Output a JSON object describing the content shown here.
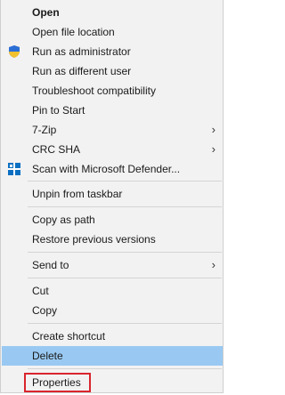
{
  "menu": {
    "items": [
      {
        "label": "Open",
        "bold": true
      },
      {
        "label": "Open file location"
      },
      {
        "label": "Run as administrator",
        "icon": "uac-shield-icon"
      },
      {
        "label": "Run as different user"
      },
      {
        "label": "Troubleshoot compatibility"
      },
      {
        "label": "Pin to Start"
      },
      {
        "label": "7-Zip",
        "submenu": true
      },
      {
        "label": "CRC SHA",
        "submenu": true
      },
      {
        "label": "Scan with Microsoft Defender...",
        "icon": "defender-icon"
      },
      {
        "label": "Unpin from taskbar"
      },
      {
        "label": "Copy as path"
      },
      {
        "label": "Restore previous versions"
      },
      {
        "label": "Send to",
        "submenu": true
      },
      {
        "label": "Cut"
      },
      {
        "label": "Copy"
      },
      {
        "label": "Create shortcut"
      },
      {
        "label": "Delete",
        "highlighted": true
      },
      {
        "label": "Properties",
        "outlined": true
      }
    ],
    "submenu_arrow": "›"
  },
  "colors": {
    "menu_background": "#f2f2f2",
    "highlight": "#99c9f2",
    "outline": "#d9252d",
    "shield_blue": "#2b6fd6",
    "shield_yellow": "#f2c12e",
    "defender_blue": "#0a6fc2"
  }
}
